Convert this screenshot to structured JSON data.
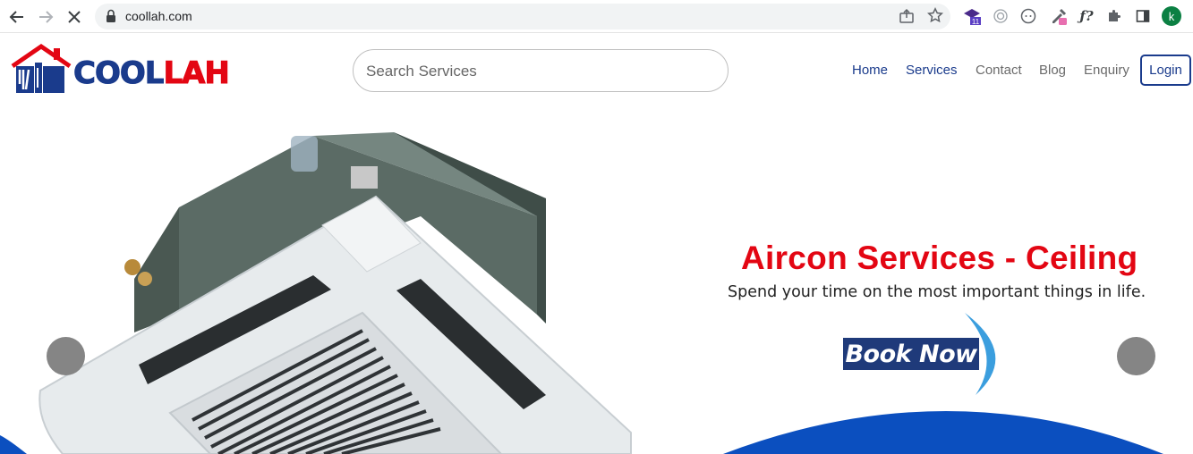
{
  "browser": {
    "url": "coollah.com",
    "avatar_letter": "k",
    "extension_badge": "11"
  },
  "site": {
    "logo_part1": "COOL",
    "logo_part2": "LAH",
    "search_placeholder": "Search Services",
    "nav": [
      "Home",
      "Services",
      "Contact",
      "Blog",
      "Enquiry"
    ],
    "login_label": "Login"
  },
  "hero": {
    "title": "Aircon Services - Ceiling",
    "subtitle": "Spend your time on the most important things in life.",
    "cta_label": "Book Now"
  },
  "colors": {
    "brand_blue": "#1a3b8c",
    "brand_red": "#e30613",
    "hero_blue": "#0b4fbf"
  }
}
